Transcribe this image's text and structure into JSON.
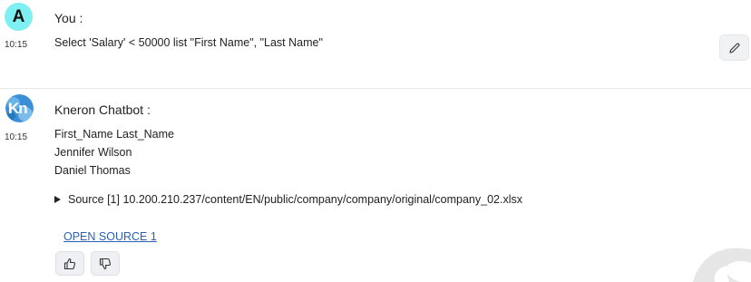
{
  "user_message": {
    "avatar_letter": "A",
    "time": "10:15",
    "sender": "You :",
    "text": "Select 'Salary' < 50000 list \"First Name\", \"Last Name\"",
    "edit_icon": "pencil-icon"
  },
  "bot_message": {
    "avatar_text": "Kn",
    "time": "10:15",
    "sender": "Kneron Chatbot :",
    "lines": [
      "First_Name Last_Name",
      "Jennifer Wilson",
      "Daniel Thomas"
    ],
    "source": "Source [1] 10.200.210.237/content/EN/public/company/company/original/company_02.xlsx",
    "open_source_label": "OPEN SOURCE 1",
    "thumbs_up_icon": "thumbs-up-icon",
    "thumbs_down_icon": "thumbs-down-icon"
  },
  "colors": {
    "user_avatar_bg": "#7ff0f2",
    "link": "#2a5fb8",
    "bot_avatar": "#3a8fd6"
  }
}
